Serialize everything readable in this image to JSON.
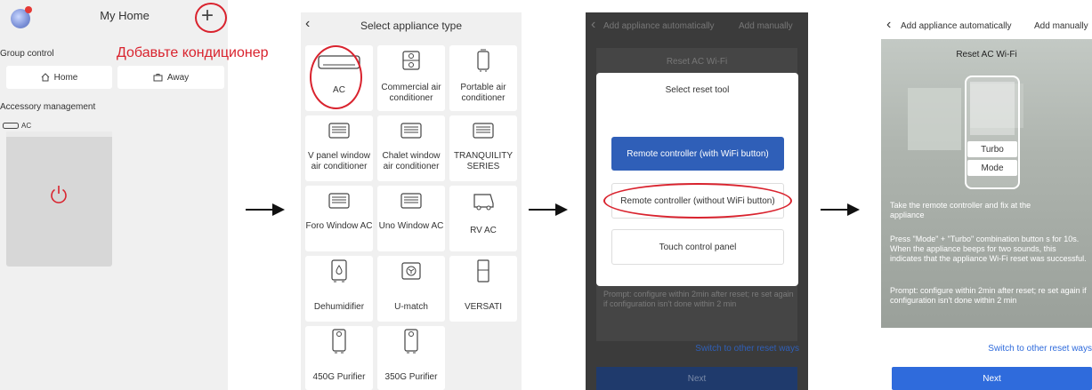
{
  "panel1": {
    "title": "My Home",
    "group_control": "Group control",
    "home": "Home",
    "away": "Away",
    "accessory_management": "Accessory management",
    "ac_label": "AC",
    "annotation": "Добавьте кондиционер"
  },
  "panel2": {
    "title": "Select appliance type",
    "tiles": [
      {
        "label": "AC",
        "icon": "ac-unit-icon"
      },
      {
        "label": "Commercial air conditioner",
        "icon": "commercial-ac-icon"
      },
      {
        "label": "Portable air conditioner",
        "icon": "portable-ac-icon"
      },
      {
        "label": "V panel window air conditioner",
        "icon": "window-ac-icon"
      },
      {
        "label": "Chalet window air conditioner",
        "icon": "window-ac-icon"
      },
      {
        "label": "TRANQUILITY SERIES",
        "icon": "window-ac-icon"
      },
      {
        "label": "Foro Window AC",
        "icon": "window-ac-icon"
      },
      {
        "label": "Uno Window AC",
        "icon": "window-ac-icon"
      },
      {
        "label": "RV AC",
        "icon": "rv-ac-icon"
      },
      {
        "label": "Dehumidifier",
        "icon": "dehumidifier-icon"
      },
      {
        "label": "U-match",
        "icon": "u-match-icon"
      },
      {
        "label": "VERSATI",
        "icon": "versati-icon"
      },
      {
        "label": "450G Purifier",
        "icon": "purifier-icon"
      },
      {
        "label": "350G Purifier",
        "icon": "purifier-icon"
      }
    ]
  },
  "panel3": {
    "tab_auto": "Add appliance automatically",
    "tab_manual": "Add manually",
    "reset_title": "Reset AC Wi-Fi",
    "modal_title": "Select reset tool",
    "option_wifi": "Remote controller (with WiFi button)",
    "option_no_wifi": "Remote controller (without WiFi button)",
    "option_touch": "Touch control panel",
    "prompt": "Prompt: configure within 2min after reset; re set again if configuration isn't done within 2 min",
    "switch_link": "Switch to other reset ways",
    "next": "Next"
  },
  "panel4": {
    "tab_auto": "Add appliance automatically",
    "tab_manual": "Add manually",
    "reset_title": "Reset AC Wi-Fi",
    "turbo": "Turbo",
    "mode": "Mode",
    "instruction1": "Take the remote controller and fix at the appliance",
    "instruction2": "Press \"Mode\" + \"Turbo\" combination button s for 10s. When the appliance beeps for two sounds, this indicates that the appliance Wi-Fi reset was successful.",
    "prompt": "Prompt: configure within 2min after reset; re set again if configuration isn't done within 2 min",
    "switch_link": "Switch to other reset ways",
    "next": "Next"
  },
  "colors": {
    "annotation_red": "#d9232e",
    "primary_blue": "#2f6bdc",
    "link_blue": "#2f6bdc"
  }
}
